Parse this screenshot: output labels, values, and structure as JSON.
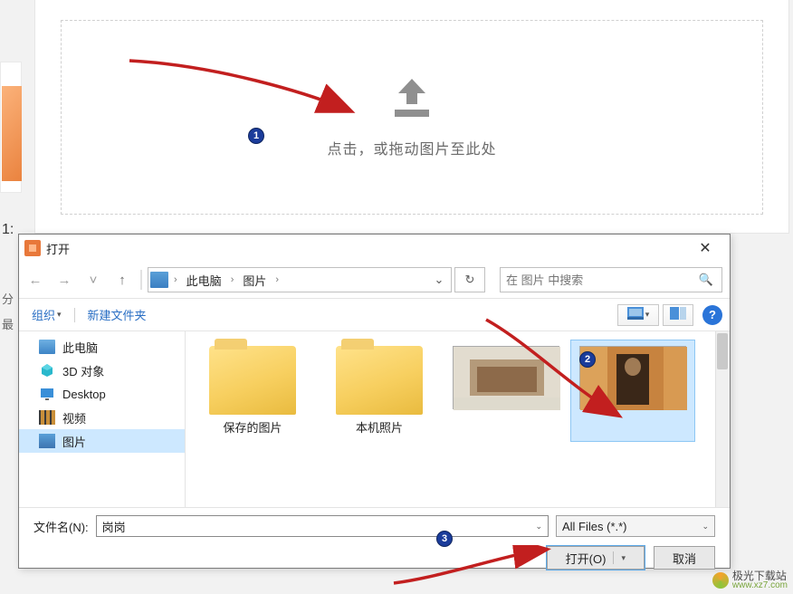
{
  "badge": {
    "b1": "1",
    "b2": "2",
    "b3": "3"
  },
  "thumb_label": "1:",
  "meta1": "分",
  "meta2": "最",
  "drop_hint": "点击，或拖动图片至此处",
  "dialog": {
    "title": "打开",
    "breadcrumb_root": "此电脑",
    "breadcrumb_folder": "图片",
    "search_placeholder": "在 图片 中搜索",
    "refresh_glyph": "↻",
    "organize": "组织",
    "new_folder": "新建文件夹"
  },
  "sidebar": {
    "items": [
      {
        "label": "此电脑"
      },
      {
        "label": "3D 对象"
      },
      {
        "label": "Desktop"
      },
      {
        "label": "视频"
      },
      {
        "label": "图片"
      }
    ]
  },
  "items": {
    "folder1": "保存的图片",
    "folder2": "本机照片",
    "photo1": "",
    "photo2": ""
  },
  "filename_label": "文件名(N):",
  "filename_value": "岗岗",
  "filter_value": "All Files (*.*)",
  "open_label": "打开(O)",
  "cancel_label": "取消",
  "watermark": {
    "line1": "极光下载站",
    "line2": "www.xz7.com"
  }
}
